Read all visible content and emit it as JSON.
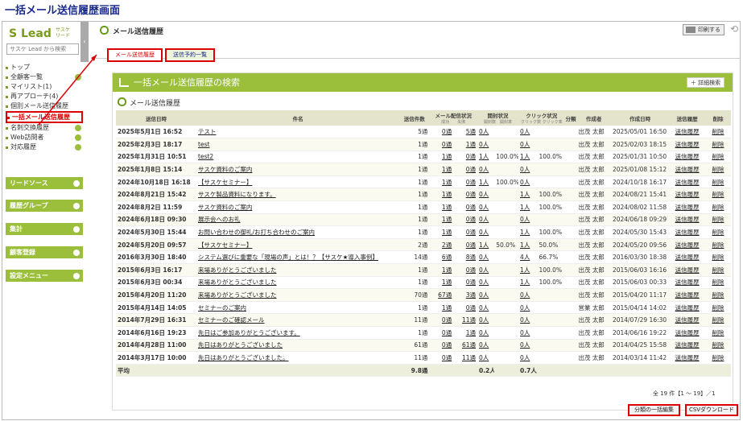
{
  "page_heading": "一括メール送信履歴画面",
  "sidebar": {
    "logo": "Lead",
    "logo_sub1": "サスケ",
    "logo_sub2": "リード",
    "search_placeholder": "サスケ Lead から検索",
    "items": [
      {
        "label": "トップ",
        "plus": false,
        "active": false
      },
      {
        "label": "全顧客一覧",
        "plus": true,
        "active": false
      },
      {
        "label": "マイリスト(1)",
        "plus": false,
        "active": false
      },
      {
        "label": "再アプローチ(4)",
        "plus": false,
        "active": false
      },
      {
        "label": "個別メール送信履歴",
        "plus": false,
        "active": false
      },
      {
        "label": "一括メール送信履歴",
        "plus": false,
        "active": true
      },
      {
        "label": "名刺交換履歴",
        "plus": true,
        "active": false
      },
      {
        "label": "Web訪問者",
        "plus": true,
        "active": false
      },
      {
        "label": "対応履歴",
        "plus": true,
        "active": false
      }
    ],
    "sections": [
      "リードソース",
      "履歴グループ",
      "集計",
      "顧客登録",
      "設定メニュー"
    ]
  },
  "header": {
    "title": "メール送信履歴",
    "print": "印刷する"
  },
  "tabs": [
    "メール送信履歴",
    "送信予約一覧"
  ],
  "panel": {
    "title": "一括メール送信履歴の検索",
    "detail_search": "＋ 詳細検索",
    "subtitle": "メール送信履歴"
  },
  "table": {
    "headers": {
      "date": "送信日時",
      "subject": "件名",
      "count": "送信件数",
      "delivery": "メール配信状況",
      "delivery_ok": "成功",
      "delivery_ng": "失敗",
      "open": "開封状況",
      "open_n": "開封数",
      "open_r": "開封率",
      "click": "クリック状況",
      "click_n": "クリック数",
      "click_r": "クリック率",
      "category": "分類",
      "author": "作成者",
      "created": "作成日時",
      "history": "送信履歴",
      "delete": "削除"
    },
    "rows": [
      [
        "2025年5月1日 16:52",
        "テスト",
        "5通",
        "0通",
        "5通",
        "0人",
        "",
        "0人",
        "",
        "",
        "出茂 太郎",
        "2025/05/01 16:50"
      ],
      [
        "2025年2月3日 18:17",
        "test",
        "1通",
        "0通",
        "1通",
        "0人",
        "",
        "0人",
        "",
        "",
        "出茂 太郎",
        "2025/02/03 18:15"
      ],
      [
        "2025年1月31日 10:51",
        "test2",
        "1通",
        "1通",
        "0通",
        "1人",
        "100.0%",
        "1人",
        "100.0%",
        "",
        "出茂 太郎",
        "2025/01/31 10:50"
      ],
      [
        "2025年1月8日 15:14",
        "サスケ資料のご案内",
        "1通",
        "1通",
        "0通",
        "0人",
        "",
        "0人",
        "",
        "",
        "出茂 太郎",
        "2025/01/08 15:12"
      ],
      [
        "2024年10月18日 16:18",
        "【サスケセミナー】",
        "1通",
        "1通",
        "0通",
        "1人",
        "100.0%",
        "0人",
        "",
        "",
        "出茂 太郎",
        "2024/10/18 16:17"
      ],
      [
        "2024年8月21日 15:42",
        "サスケ製品資料になります。",
        "1通",
        "1通",
        "0通",
        "0人",
        "",
        "1人",
        "100.0%",
        "",
        "出茂 太郎",
        "2024/08/21 15:41"
      ],
      [
        "2024年8月2日 11:59",
        "サスケ資料のご案内",
        "1通",
        "1通",
        "0通",
        "0人",
        "",
        "1人",
        "100.0%",
        "",
        "出茂 太郎",
        "2024/08/02 11:58"
      ],
      [
        "2024年6月18日 09:30",
        "展示会へのお礼",
        "1通",
        "1通",
        "0通",
        "0人",
        "",
        "0人",
        "",
        "",
        "出茂 太郎",
        "2024/06/18 09:29"
      ],
      [
        "2024年5月30日 15:44",
        "お問い合わせの御礼/お打ち合わせのご案内",
        "1通",
        "1通",
        "0通",
        "0人",
        "",
        "1人",
        "100.0%",
        "",
        "出茂 太郎",
        "2024/05/30 15:43"
      ],
      [
        "2024年5月20日 09:57",
        "【サスケセミナー】",
        "2通",
        "2通",
        "0通",
        "1人",
        "50.0%",
        "1人",
        "50.0%",
        "",
        "出茂 太郎",
        "2024/05/20 09:56"
      ],
      [
        "2016年3月30日 18:40",
        "システム選びに重要な「現場の声」とは！？【サスケ★導入事例】",
        "14通",
        "6通",
        "8通",
        "0人",
        "",
        "4人",
        "66.7%",
        "",
        "出茂 太郎",
        "2016/03/30 18:38"
      ],
      [
        "2015年6月3日 16:17",
        "来場ありがとうございました",
        "1通",
        "1通",
        "0通",
        "0人",
        "",
        "1人",
        "100.0%",
        "",
        "出茂 太郎",
        "2015/06/03 16:16"
      ],
      [
        "2015年6月3日 00:34",
        "来場ありがとうございました",
        "1通",
        "1通",
        "0通",
        "0人",
        "",
        "1人",
        "100.0%",
        "",
        "出茂 太郎",
        "2015/06/03 00:33"
      ],
      [
        "2015年4月20日 11:20",
        "来場ありがとうございました",
        "70通",
        "67通",
        "3通",
        "0人",
        "",
        "0人",
        "",
        "",
        "出茂 太郎",
        "2015/04/20 11:17"
      ],
      [
        "2015年4月14日 14:05",
        "セミナーのご案内",
        "1通",
        "1通",
        "0通",
        "0人",
        "",
        "0人",
        "",
        "",
        "営業 太郎",
        "2015/04/14 14:02"
      ],
      [
        "2014年7月29日 16:31",
        "セミナーのご確認メール",
        "11通",
        "0通",
        "11通",
        "0人",
        "",
        "0人",
        "",
        "",
        "出茂 太郎",
        "2014/07/29 16:30"
      ],
      [
        "2014年6月16日 19:23",
        "先日はご参加ありがとうございます。",
        "1通",
        "0通",
        "1通",
        "0人",
        "",
        "0人",
        "",
        "",
        "出茂 太郎",
        "2014/06/16 19:22"
      ],
      [
        "2014年4月28日 11:00",
        "先日はありがとうございました",
        "61通",
        "0通",
        "61通",
        "0人",
        "",
        "0人",
        "",
        "",
        "出茂 太郎",
        "2014/04/25 15:58"
      ],
      [
        "2014年3月17日 10:00",
        "先日はありがとうございました。",
        "11通",
        "0通",
        "11通",
        "0人",
        "",
        "0人",
        "",
        "",
        "出茂 太郎",
        "2014/03/14 11:42"
      ]
    ],
    "link_history": "送信履歴",
    "link_delete": "削除",
    "avg_label": "平均",
    "avg_count": "9.8通",
    "avg_open": "0.2人",
    "avg_click": "0.7人"
  },
  "footer": {
    "count": "全 19 件【1 ～ 19】／1",
    "bulk_edit": "分類の一括編集",
    "csv": "CSVダウンロード"
  },
  "colors": {
    "accent": "#9bbf3b",
    "highlight": "#dd0000"
  }
}
